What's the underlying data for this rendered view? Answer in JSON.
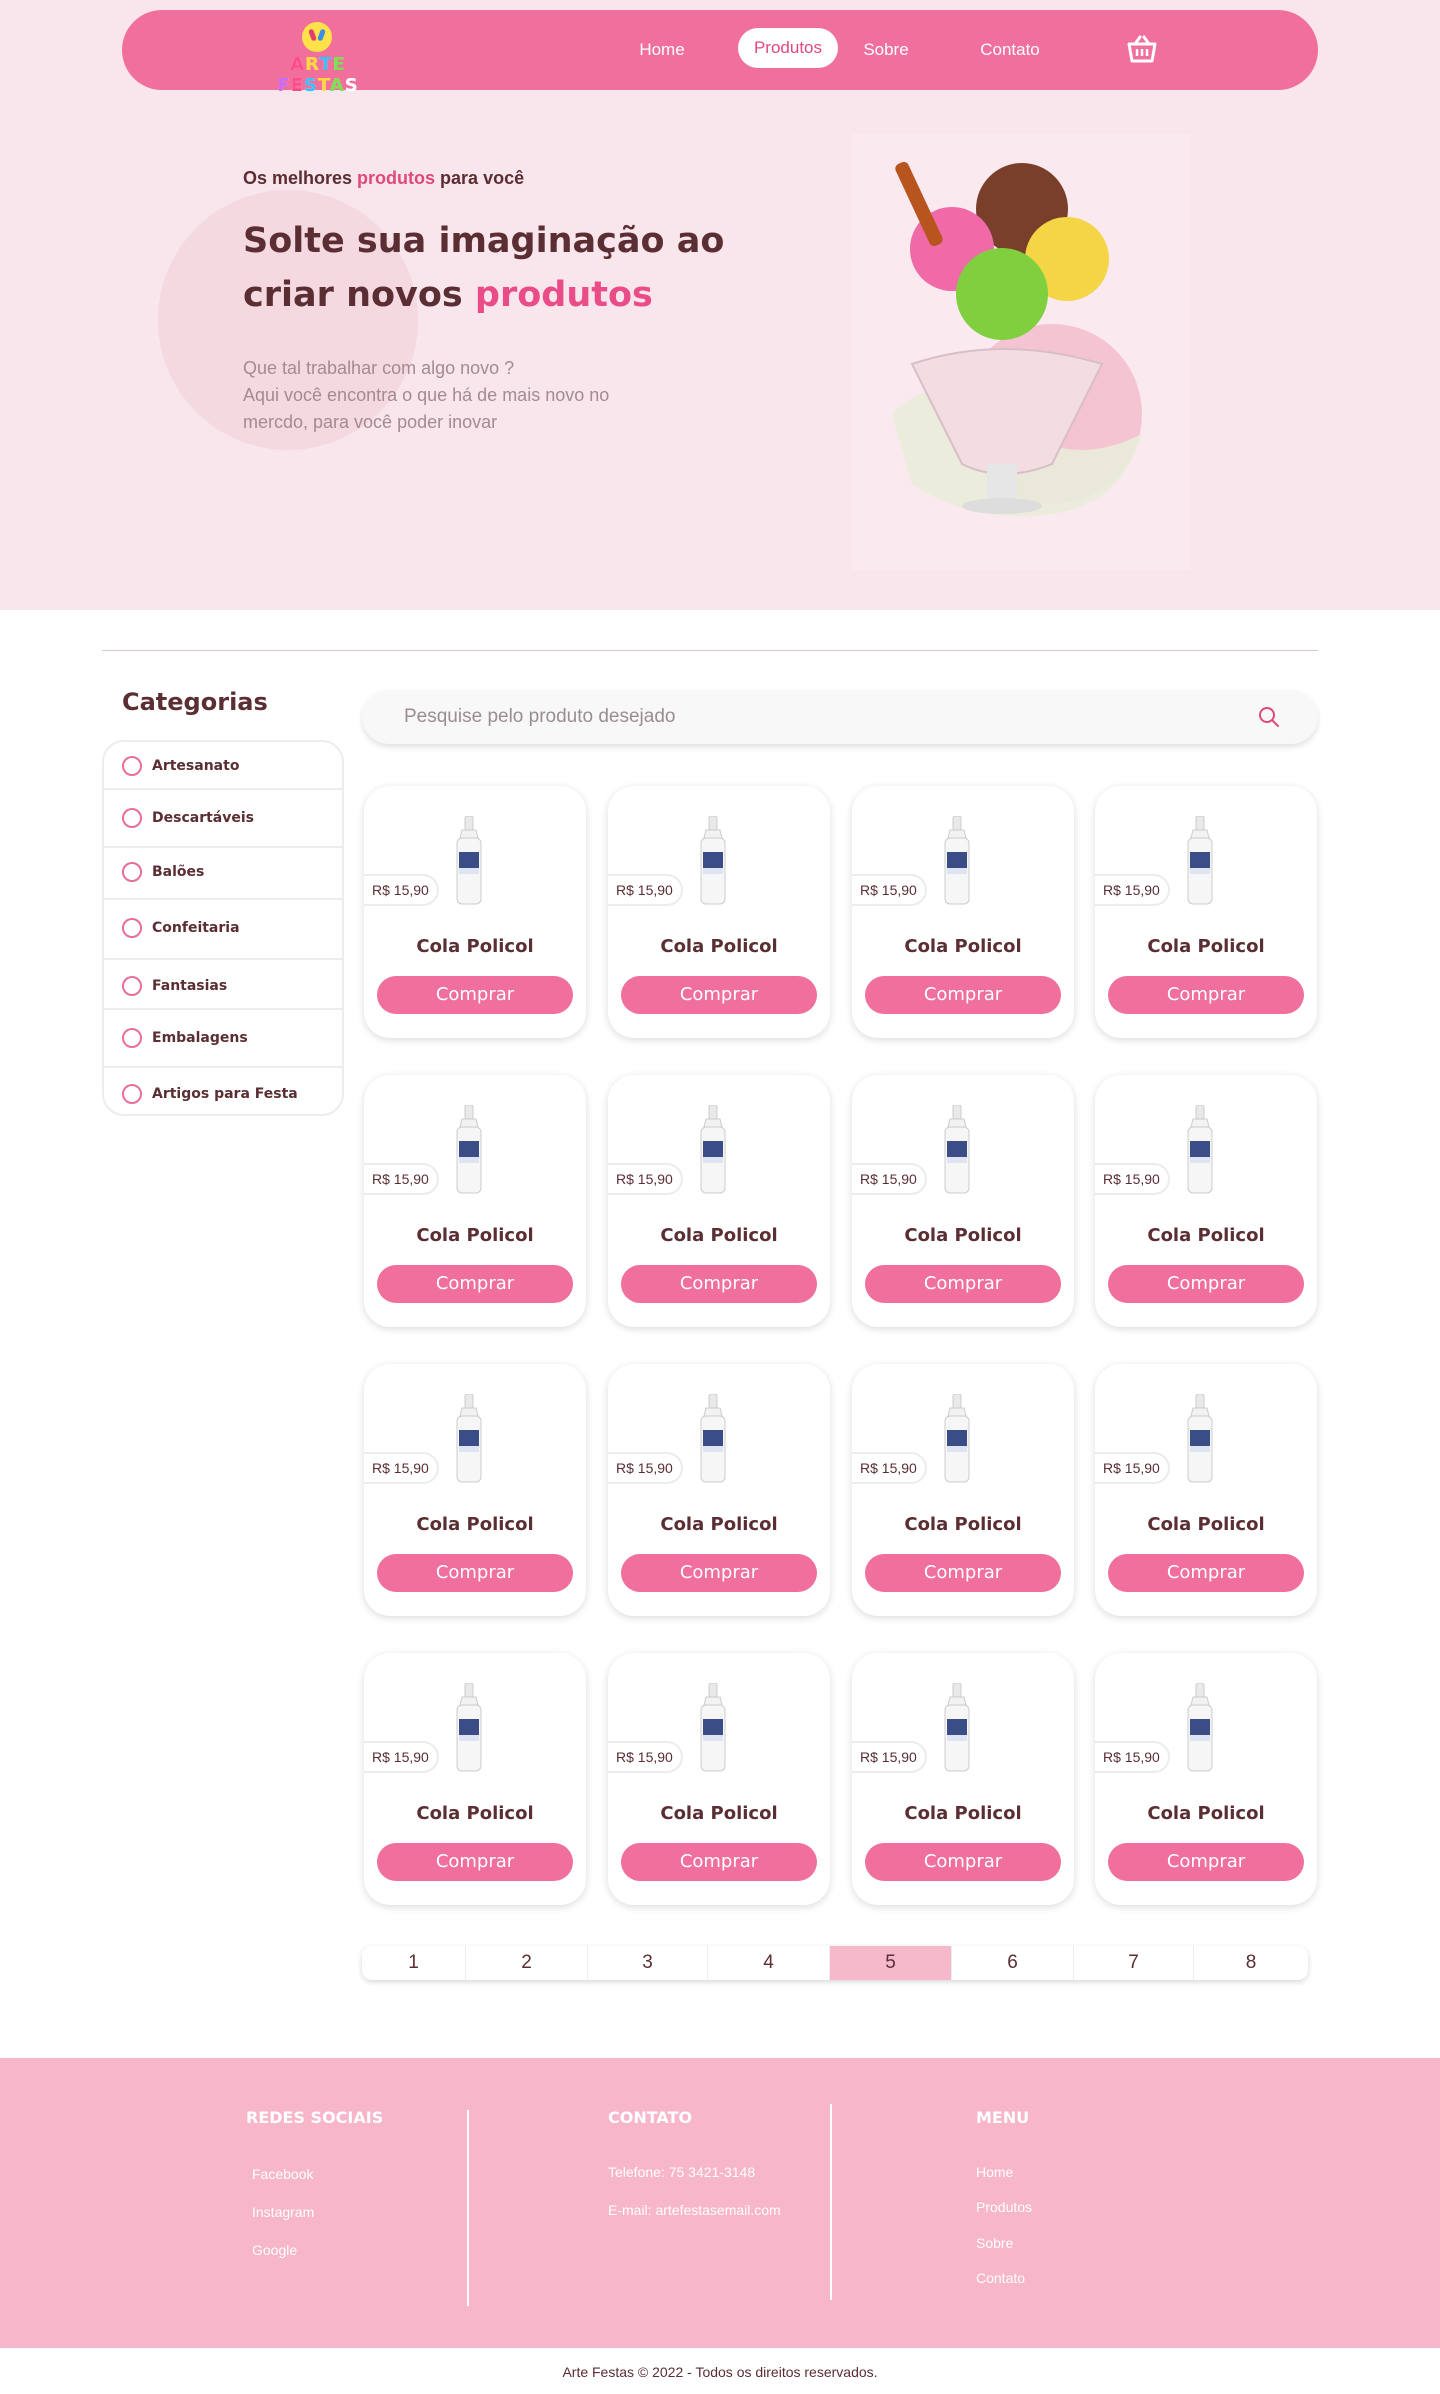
{
  "brand": {
    "logo_text": [
      "A",
      "R",
      "T",
      "E",
      " ",
      "F",
      "E",
      "S",
      "T",
      "A",
      "S"
    ]
  },
  "nav": {
    "links": [
      "Home",
      "Produtos",
      "Sobre",
      "Contato"
    ],
    "active": "Produtos",
    "cart_icon": "cart-icon"
  },
  "hero": {
    "subtitle_prefix": "Os melhores ",
    "subtitle_highlight": "produtos",
    "subtitle_suffix": " para você",
    "title_line1": "Solte sua imaginação ao",
    "title_line2_prefix": "criar novos ",
    "title_line2_highlight": "produtos",
    "desc_line1": "Que tal trabalhar com algo novo ?",
    "desc_line2": "Aqui você encontra o que há de mais novo no",
    "desc_line3": "mercdo, para você poder inovar",
    "image_icon": "ice-cream-sundae-image"
  },
  "categories": {
    "title": "Categorias",
    "items": [
      "Artesanato",
      "Descartáveis",
      "Balões",
      "Confeitaria",
      "Fantasias",
      "Embalagens",
      "Artigos para Festa"
    ]
  },
  "search": {
    "placeholder": "Pesquise pelo produto desejado",
    "icon": "search-icon"
  },
  "products": {
    "items": [
      {
        "name": "Cola Policol",
        "price": "R$ 15,90",
        "button": "Comprar"
      },
      {
        "name": "Cola Policol",
        "price": "R$ 15,90",
        "button": "Comprar"
      },
      {
        "name": "Cola Policol",
        "price": "R$ 15,90",
        "button": "Comprar"
      },
      {
        "name": "Cola Policol",
        "price": "R$ 15,90",
        "button": "Comprar"
      },
      {
        "name": "Cola Policol",
        "price": "R$ 15,90",
        "button": "Comprar"
      },
      {
        "name": "Cola Policol",
        "price": "R$ 15,90",
        "button": "Comprar"
      },
      {
        "name": "Cola Policol",
        "price": "R$ 15,90",
        "button": "Comprar"
      },
      {
        "name": "Cola Policol",
        "price": "R$ 15,90",
        "button": "Comprar"
      },
      {
        "name": "Cola Policol",
        "price": "R$ 15,90",
        "button": "Comprar"
      },
      {
        "name": "Cola Policol",
        "price": "R$ 15,90",
        "button": "Comprar"
      },
      {
        "name": "Cola Policol",
        "price": "R$ 15,90",
        "button": "Comprar"
      },
      {
        "name": "Cola Policol",
        "price": "R$ 15,90",
        "button": "Comprar"
      },
      {
        "name": "Cola Policol",
        "price": "R$ 15,90",
        "button": "Comprar"
      },
      {
        "name": "Cola Policol",
        "price": "R$ 15,90",
        "button": "Comprar"
      },
      {
        "name": "Cola Policol",
        "price": "R$ 15,90",
        "button": "Comprar"
      },
      {
        "name": "Cola Policol",
        "price": "R$ 15,90",
        "button": "Comprar"
      }
    ]
  },
  "pagination": {
    "pages": [
      "1",
      "2",
      "3",
      "4",
      "5",
      "6",
      "7",
      "8"
    ],
    "current": "5"
  },
  "footer": {
    "social_title": "REDES SOCIAIS",
    "social_links": [
      "Facebook",
      "Instagram",
      "Google"
    ],
    "contact_title": "CONTATO",
    "contact_phone": "Telefone: 75 3421-3148",
    "contact_email": "E-mail: artefestasemail.com",
    "menu_title": "MENU",
    "menu_links": [
      "Home",
      "Produtos",
      "Sobre",
      "Contato"
    ],
    "copyright": "Arte Festas © 2022 - Todos os direitos reservados."
  },
  "colors": {
    "primary_pink": "#f06f9c",
    "accent_pink": "#e0497e",
    "brown_text": "#5a2e33",
    "footer_bg": "#f8b6ca",
    "hero_bg": "#f8e6ec"
  }
}
